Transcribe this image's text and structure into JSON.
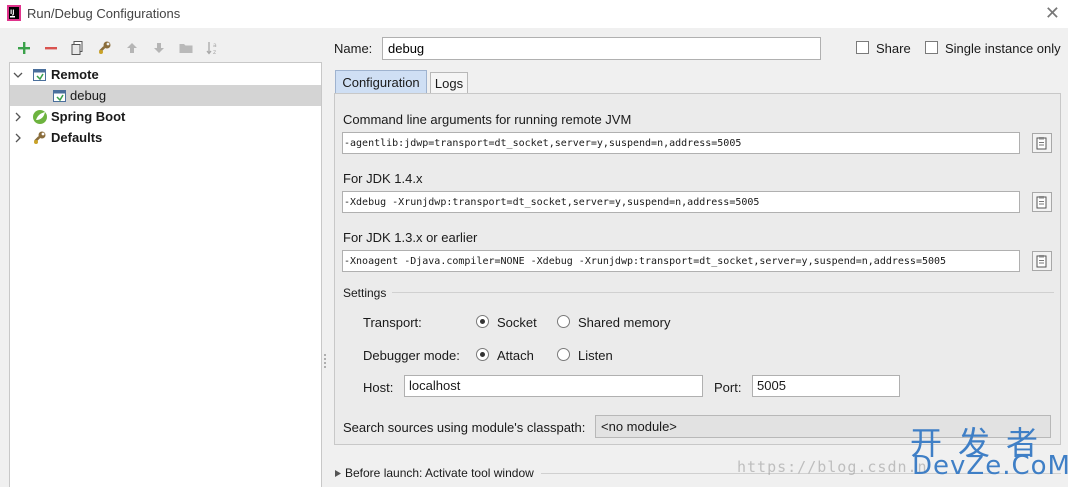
{
  "window": {
    "title": "Run/Debug Configurations"
  },
  "toolbar": {
    "icons": [
      "add-icon",
      "remove-icon",
      "copy-icon",
      "wrench-icon",
      "arrow-up-icon",
      "arrow-down-icon",
      "folder-icon",
      "sort-icon"
    ]
  },
  "tree": {
    "items": [
      {
        "label": "Remote",
        "expanded": true,
        "bold": true,
        "icon": "remote-icon"
      },
      {
        "label": "debug",
        "selected": true,
        "icon": "remote-config-icon"
      },
      {
        "label": "Spring Boot",
        "expanded": false,
        "bold": true,
        "icon": "spring-boot-icon"
      },
      {
        "label": "Defaults",
        "expanded": false,
        "bold": true,
        "icon": "wrench-defaults-icon"
      }
    ]
  },
  "header": {
    "name_label": "Name:",
    "name_value": "debug",
    "share_label": "Share",
    "share_checked": false,
    "single_instance_label": "Single instance only",
    "single_instance_checked": false
  },
  "tabs": [
    {
      "label": "Configuration",
      "active": true
    },
    {
      "label": "Logs",
      "active": false
    }
  ],
  "config": {
    "cmd_label": "Command line arguments for running remote JVM",
    "cmd_value": "-agentlib:jdwp=transport=dt_socket,server=y,suspend=n,address=5005",
    "jdk14_label": "For JDK 1.4.x",
    "jdk14_value": "-Xdebug -Xrunjdwp:transport=dt_socket,server=y,suspend=n,address=5005",
    "jdk13_label": "For JDK 1.3.x or earlier",
    "jdk13_value": "-Xnoagent -Djava.compiler=NONE -Xdebug -Xrunjdwp:transport=dt_socket,server=y,suspend=n,address=5005",
    "settings_label": "Settings",
    "transport_label": "Transport:",
    "transport_options": [
      "Socket",
      "Shared memory"
    ],
    "transport_selected": "Socket",
    "debugger_mode_label": "Debugger mode:",
    "debugger_mode_options": [
      "Attach",
      "Listen"
    ],
    "debugger_mode_selected": "Attach",
    "host_label": "Host:",
    "host_value": "localhost",
    "port_label": "Port:",
    "port_value": "5005",
    "module_label": "Search sources using module's classpath:",
    "module_value": "<no module>"
  },
  "before_launch": {
    "label": "Before launch: Activate tool window"
  },
  "watermark": {
    "url": "https://blog.csdn.n",
    "cn": "开发者",
    "en": "DevZe.CoM"
  },
  "colors": {
    "accent_tab": "#cfdff4",
    "add_green": "#3aa14a",
    "remove_red": "#d9534f",
    "watermark_blue": "#3f7fc6"
  }
}
